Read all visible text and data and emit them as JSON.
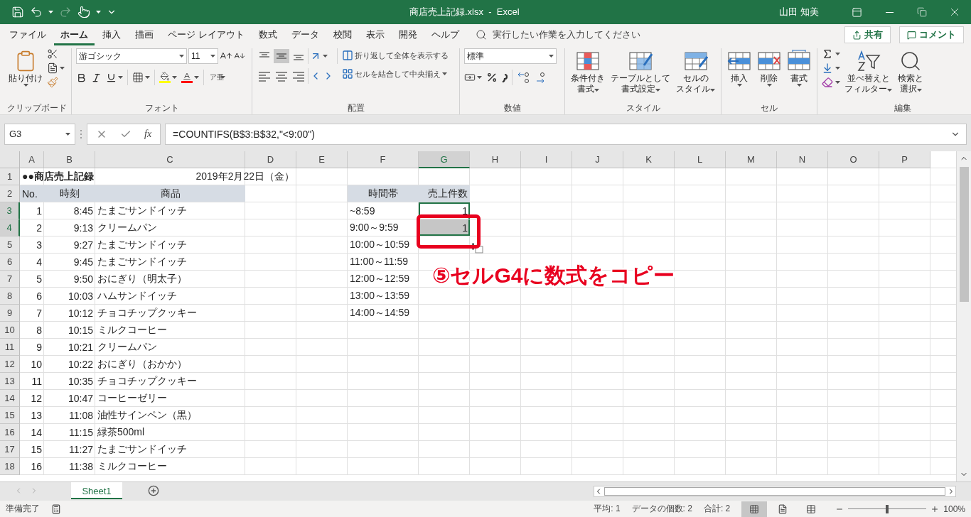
{
  "title_bar": {
    "title": "商店売上記録.xlsx  -  Excel",
    "user": "山田 知美"
  },
  "menu": {
    "tabs": [
      {
        "label": "ファイル",
        "selected": false
      },
      {
        "label": "ホーム",
        "selected": true
      },
      {
        "label": "挿入",
        "selected": false
      },
      {
        "label": "描画",
        "selected": false
      },
      {
        "label": "ページ レイアウト",
        "selected": false
      },
      {
        "label": "数式",
        "selected": false
      },
      {
        "label": "データ",
        "selected": false
      },
      {
        "label": "校閲",
        "selected": false
      },
      {
        "label": "表示",
        "selected": false
      },
      {
        "label": "開発",
        "selected": false
      },
      {
        "label": "ヘルプ",
        "selected": false
      }
    ],
    "search_placeholder": "実行したい作業を入力してください",
    "share": "共有",
    "comment": "コメント"
  },
  "ribbon": {
    "clipboard": {
      "label": "クリップボード",
      "paste": "貼り付け"
    },
    "font": {
      "label": "フォント",
      "font_name": "游ゴシック",
      "font_size": "11",
      "phonetic": "ア亜"
    },
    "alignment": {
      "label": "配置",
      "vertical": [
        {
          "kind": "top",
          "selected": false
        },
        {
          "kind": "middle",
          "selected": true
        },
        {
          "kind": "bottom",
          "selected": false
        }
      ],
      "wrap_text": "折り返して全体を表示する",
      "merge_center": "セルを結合して中央揃え"
    },
    "number": {
      "label": "数値",
      "format": "標準"
    },
    "styles": {
      "label": "スタイル",
      "buttons": [
        {
          "kind": "conditional",
          "lines": [
            "条件付き",
            "書式"
          ]
        },
        {
          "kind": "table",
          "lines": [
            "テーブルとして",
            "書式設定"
          ]
        },
        {
          "kind": "cell",
          "lines": [
            "セルの",
            "スタイル"
          ]
        }
      ]
    },
    "cells": {
      "label": "セル",
      "buttons": [
        {
          "kind": "insert",
          "label": "挿入"
        },
        {
          "kind": "delete",
          "label": "削除"
        },
        {
          "kind": "format",
          "label": "書式"
        }
      ]
    },
    "editing": {
      "label": "編集",
      "buttons": [
        {
          "kind": "sort",
          "lines": [
            "並べ替えと",
            "フィルター"
          ]
        },
        {
          "kind": "find",
          "lines": [
            "検索と",
            "選択"
          ]
        }
      ]
    }
  },
  "formula_bar": {
    "name_box": "G3",
    "fx": "fx",
    "formula": "=COUNTIFS(B$3:B$32,\"<9:00\")"
  },
  "sheet": {
    "columns": [
      {
        "label": "A",
        "selected": false
      },
      {
        "label": "B",
        "selected": false
      },
      {
        "label": "C",
        "selected": false
      },
      {
        "label": "D",
        "selected": false
      },
      {
        "label": "E",
        "selected": false
      },
      {
        "label": "F",
        "selected": false
      },
      {
        "label": "G",
        "selected": true
      },
      {
        "label": "H",
        "selected": false
      },
      {
        "label": "I",
        "selected": false
      },
      {
        "label": "J",
        "selected": false
      },
      {
        "label": "K",
        "selected": false
      },
      {
        "label": "L",
        "selected": false
      },
      {
        "label": "M",
        "selected": false
      },
      {
        "label": "N",
        "selected": false
      },
      {
        "label": "O",
        "selected": false
      },
      {
        "label": "P",
        "selected": false
      }
    ],
    "rows": [
      {
        "label": "1",
        "selected": false
      },
      {
        "label": "2",
        "selected": false
      },
      {
        "label": "3",
        "selected": true
      },
      {
        "label": "4",
        "selected": true
      },
      {
        "label": "5",
        "selected": false
      },
      {
        "label": "6",
        "selected": false
      },
      {
        "label": "7",
        "selected": false
      },
      {
        "label": "8",
        "selected": false
      },
      {
        "label": "9",
        "selected": false
      },
      {
        "label": "10",
        "selected": false
      },
      {
        "label": "11",
        "selected": false
      },
      {
        "label": "12",
        "selected": false
      },
      {
        "label": "13",
        "selected": false
      },
      {
        "label": "14",
        "selected": false
      },
      {
        "label": "15",
        "selected": false
      },
      {
        "label": "16",
        "selected": false
      },
      {
        "label": "17",
        "selected": false
      },
      {
        "label": "18",
        "selected": false
      }
    ],
    "title": "●●商店売上記録",
    "date": "2019年2月22日（金）",
    "sales_header": [
      "No.",
      "時刻",
      "商品"
    ],
    "summary_header": [
      "時間帯",
      "売上件数"
    ],
    "sales": [
      {
        "no": "1",
        "time": "8:45",
        "item": "たまごサンドイッチ"
      },
      {
        "no": "2",
        "time": "9:13",
        "item": "クリームパン"
      },
      {
        "no": "3",
        "time": "9:27",
        "item": "たまごサンドイッチ"
      },
      {
        "no": "4",
        "time": "9:45",
        "item": "たまごサンドイッチ"
      },
      {
        "no": "5",
        "time": "9:50",
        "item": "おにぎり（明太子）"
      },
      {
        "no": "6",
        "time": "10:03",
        "item": "ハムサンドイッチ"
      },
      {
        "no": "7",
        "time": "10:12",
        "item": "チョコチップクッキー"
      },
      {
        "no": "8",
        "time": "10:15",
        "item": "ミルクコーヒー"
      },
      {
        "no": "9",
        "time": "10:21",
        "item": "クリームパン"
      },
      {
        "no": "10",
        "time": "10:22",
        "item": "おにぎり（おかか）"
      },
      {
        "no": "11",
        "time": "10:35",
        "item": "チョコチップクッキー"
      },
      {
        "no": "12",
        "time": "10:47",
        "item": "コーヒーゼリー"
      },
      {
        "no": "13",
        "time": "11:08",
        "item": "油性サインペン（黒）"
      },
      {
        "no": "14",
        "time": "11:15",
        "item": "緑茶500ml"
      },
      {
        "no": "15",
        "time": "11:27",
        "item": "たまごサンドイッチ"
      },
      {
        "no": "16",
        "time": "11:38",
        "item": "ミルクコーヒー"
      }
    ],
    "summary": [
      {
        "band": "~8:59",
        "count": "1",
        "selected": true,
        "active": true
      },
      {
        "band": "9:00～9:59",
        "count": "1",
        "selected": true,
        "active": false
      },
      {
        "band": "10:00～10:59",
        "selected": false,
        "active": false
      },
      {
        "band": "11:00～11:59",
        "selected": false,
        "active": false
      },
      {
        "band": "12:00～12:59",
        "selected": false,
        "active": false
      },
      {
        "band": "13:00～13:59",
        "selected": false,
        "active": false
      },
      {
        "band": "14:00～14:59",
        "selected": false,
        "active": false
      }
    ]
  },
  "annotation": {
    "text": "⑤セルG4に数式をコピー"
  },
  "sheet_tabs": [
    {
      "label": "Sheet1",
      "selected": true
    }
  ],
  "status_bar": {
    "mode": "準備完了",
    "stats": [
      "平均: 1",
      "データの個数: 2",
      "合計: 2"
    ],
    "views": [
      {
        "kind": "normal",
        "selected": true
      },
      {
        "kind": "page_layout",
        "selected": false
      },
      {
        "kind": "page_break",
        "selected": false
      }
    ],
    "zoom": {
      "level": 0.5,
      "reading": "100%"
    }
  }
}
